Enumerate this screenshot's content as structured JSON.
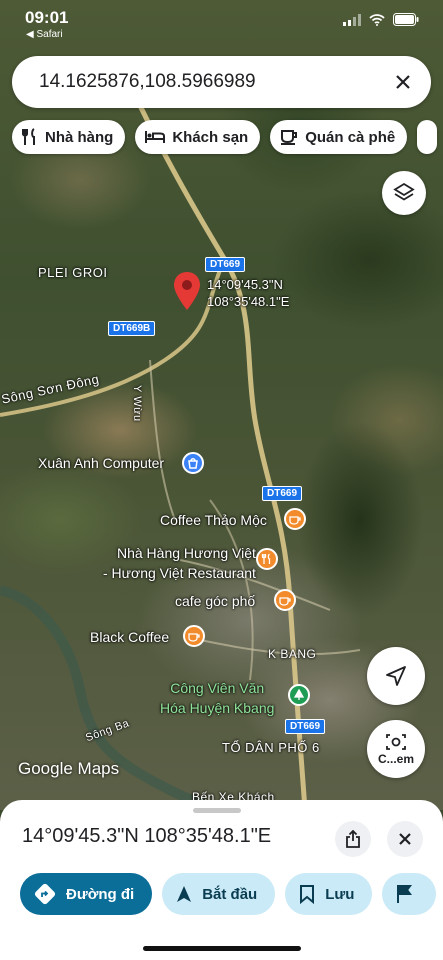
{
  "status_bar": {
    "time": "09:01",
    "back_label": "◀ Safari"
  },
  "search": {
    "query": "14.1625876,108.5966989"
  },
  "chips": [
    {
      "label": "Nhà hàng",
      "icon": "fork-knife-icon"
    },
    {
      "label": "Khách sạn",
      "icon": "bed-icon"
    },
    {
      "label": "Quán cà phê",
      "icon": "coffee-cup-icon"
    }
  ],
  "map": {
    "pin_coords_line1": "14°09'45.3\"N",
    "pin_coords_line2": "108°35'48.1\"E",
    "labels": {
      "plei_groi": "PLEI GROI",
      "song_son_dong": "Sông Sơn Đông",
      "y_wuu": "Y Wừu",
      "kbang": "K BANG",
      "to_dan_pho": "TỔ DÂN PHỐ 6",
      "song_ba": "Sông Ba",
      "ben_xe": "Bến Xe Khách"
    },
    "routes": {
      "dt669_top": "DT669",
      "dt669b": "DT669B",
      "dt669_mid": "DT669",
      "dt669_bottom": "DT669"
    },
    "pois": {
      "xuan_anh": "Xuân Anh Computer",
      "coffee_thao_moc": "Coffee Thảo Mộc",
      "nha_hang_1": "Nhà Hàng Hương Việt",
      "nha_hang_2": "- Hương Việt Restaurant",
      "cafe_goc_pho": "cafe góc phố",
      "black_coffee": "Black Coffee",
      "cong_vien_1": "Công Viên Văn",
      "cong_vien_2": "Hóa Huyện Kbang"
    },
    "logo": "Google Maps",
    "camera_label": "C...em"
  },
  "sheet": {
    "coords": "14°09'45.3\"N 108°35'48.1\"E",
    "actions": [
      {
        "label": "Đường đi",
        "icon": "directions-icon"
      },
      {
        "label": "Bắt đầu",
        "icon": "navigation-arrow-icon"
      },
      {
        "label": "Lưu",
        "icon": "bookmark-icon"
      }
    ]
  },
  "colors": {
    "primary_action": "#0b6e99",
    "secondary_action": "#c9eaf6",
    "route_badge": "#1a73e8",
    "pin_red": "#e53935",
    "poi_orange": "#f28b2c"
  }
}
